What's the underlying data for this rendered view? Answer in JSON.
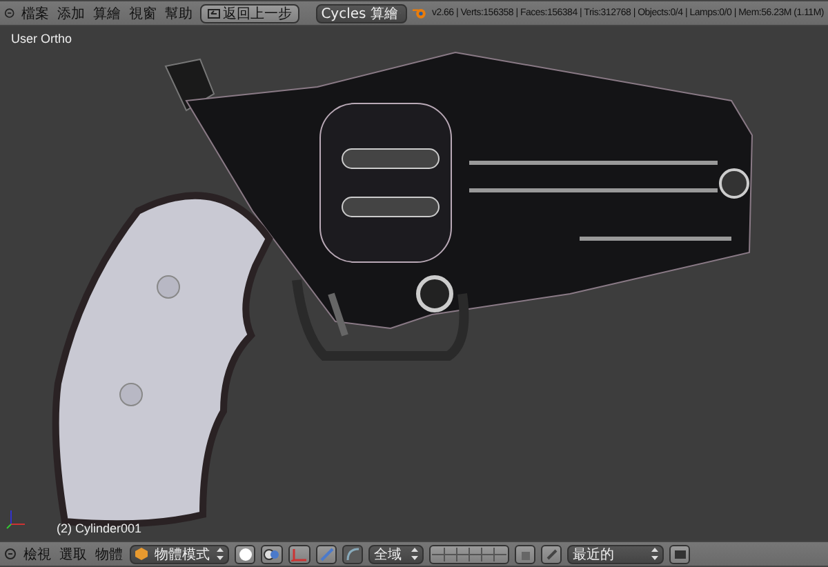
{
  "top_bar": {
    "menu_items": [
      "檔案",
      "添加",
      "算繪",
      "視窗",
      "幫助"
    ],
    "undo_button": "返回上一步",
    "render_engine": "Cycles 算繪",
    "stats": "v2.66 | Verts:156358 | Faces:156384 | Tris:312768 | Objects:0/4 | Lamps:0/0 | Mem:56.23M (1.11M)"
  },
  "viewport": {
    "view_label": "User Ortho",
    "object_label": "(2) Cylinder001"
  },
  "bottom_bar": {
    "menu_items": [
      "檢視",
      "選取",
      "物體"
    ],
    "mode": "物體模式",
    "transform_orientation": "全域",
    "snap_target": "最近的"
  }
}
